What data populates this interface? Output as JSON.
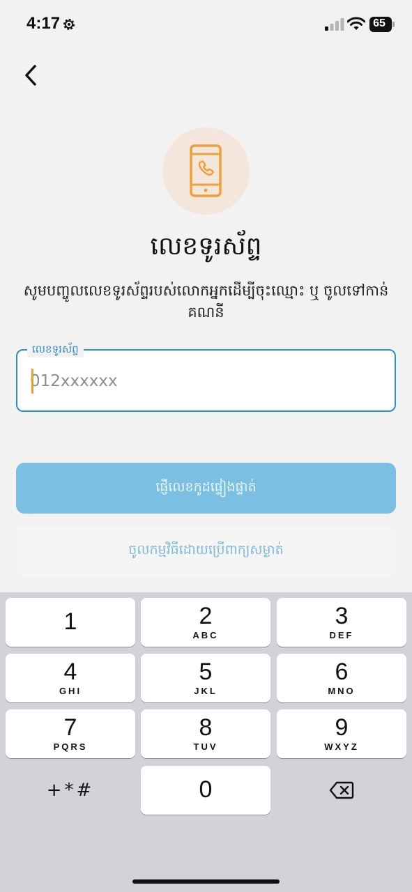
{
  "status_bar": {
    "time": "4:17",
    "battery": "65",
    "icons": [
      "gear-icon",
      "signal-icon",
      "wifi-icon",
      "battery-icon"
    ]
  },
  "header": {
    "back_icon": "chevron-left-icon"
  },
  "hero": {
    "icon": "phone-call-icon",
    "icon_color": "#F0A03A",
    "circle_color": "#F5E6DC"
  },
  "content": {
    "title": "លេខទូរស័ព្ទ",
    "subtitle": "សូមបញ្ចូលលេខទូរស័ព្ទរបស់លោកអ្នកដើម្បីចុះឈ្មោះ ឬ ចូលទៅកាន់គណនី"
  },
  "phone_field": {
    "label": "លេខទូរស័ព្ទ",
    "value": "",
    "placeholder": "012xxxxxx",
    "border_color": "#2C8FC2"
  },
  "buttons": {
    "send_code": "ផ្ញើលេខកូដផ្ទៀងផ្ទាត់",
    "login_password": "ចូលកម្មវិធីដោយប្រើពាក្យសម្ងាត់",
    "primary_color": "#7BBFE3"
  },
  "keypad": {
    "keys": [
      {
        "digit": "1",
        "letters": ""
      },
      {
        "digit": "2",
        "letters": "ABC"
      },
      {
        "digit": "3",
        "letters": "DEF"
      },
      {
        "digit": "4",
        "letters": "GHI"
      },
      {
        "digit": "5",
        "letters": "JKL"
      },
      {
        "digit": "6",
        "letters": "MNO"
      },
      {
        "digit": "7",
        "letters": "PQRS"
      },
      {
        "digit": "8",
        "letters": "TUV"
      },
      {
        "digit": "9",
        "letters": "WXYZ"
      },
      {
        "digit": "0",
        "letters": ""
      }
    ],
    "symbols": "+*#",
    "delete_icon": "backspace-icon"
  }
}
